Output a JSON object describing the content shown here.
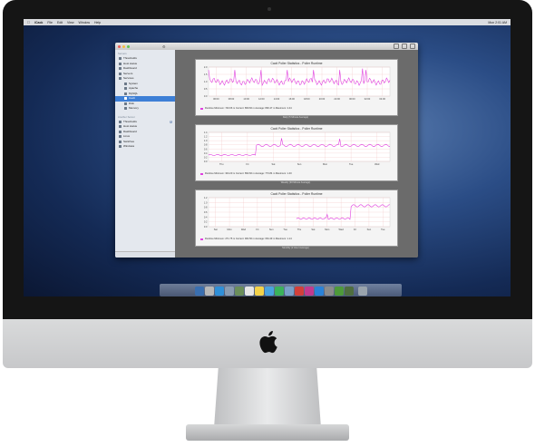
{
  "menubar": {
    "items": [
      "iCack",
      "File",
      "Edit",
      "View",
      "Window",
      "Help"
    ],
    "right": "Mon 2:01 AM"
  },
  "sidebar": {
    "group1_label": "Servers",
    "items": [
      {
        "label": "Thresholds",
        "sub": false
      },
      {
        "label": "Host status",
        "sub": false
      },
      {
        "label": "Dashboard",
        "sub": false
      },
      {
        "label": "Servers",
        "sub": false
      },
      {
        "label": "Services",
        "sub": false
      },
      {
        "label": "System",
        "sub": true
      },
      {
        "label": "Apache",
        "sub": true
      },
      {
        "label": "MySQL",
        "sub": true
      },
      {
        "label": "Cacti",
        "sub": true,
        "selected": true
      },
      {
        "label": "Disk",
        "sub": true
      },
      {
        "label": "Memory",
        "sub": true
      }
    ],
    "group2_label": "Another Server",
    "items2": [
      {
        "label": "Thresholds",
        "badge": "2"
      },
      {
        "label": "Host status"
      },
      {
        "label": "Dashboard"
      },
      {
        "label": "Linux"
      },
      {
        "label": "Switches"
      },
      {
        "label": "Windows"
      }
    ]
  },
  "graphs": [
    {
      "title": "Cacti Poller Statistics - Poller Runtime",
      "legend": "Runtime  Minimum:  740.66 m  Current:  869.66 m  Average:  890.47 m  Maximum:  2.44",
      "caption": "Daily (5 Minute Average)",
      "ylabels": [
        "2.0",
        "1.5",
        "1.0",
        "0.5",
        "0.0"
      ],
      "xlabels": [
        "06:00",
        "08:00",
        "10:00",
        "12:00",
        "14:00",
        "16:00",
        "18:00",
        "20:00",
        "22:00",
        "00:00",
        "02:00",
        "04:00"
      ]
    },
    {
      "title": "Cacti Poller Statistics - Poller Runtime",
      "legend": "Runtime  Minimum:  304.20 m  Current:  893.66 m  Average:  773.84 m  Maximum:  1.40",
      "caption": "Weekly (30 Minute Average)",
      "ylabels": [
        "1.4",
        "1.2",
        "1.0",
        "0.8",
        "0.6",
        "0.4",
        "0.2",
        "0.0"
      ],
      "xlabels": [
        "Thu",
        "Fri",
        "Sat",
        "Sun",
        "Mon",
        "Tue",
        "Wed"
      ]
    },
    {
      "title": "Cacti Poller Statistics - Poller Runtime",
      "legend": "Runtime  Minimum:  271.75 m  Current:  904.56 m  Average:  664.49 m  Maximum:  1.14",
      "caption": "Monthly (2 Hour Average)",
      "ylabels": [
        "1.2",
        "1.0",
        "0.8",
        "0.6",
        "0.4",
        "0.2",
        "0.0"
      ],
      "xlabels": [
        "Sat",
        "Mon",
        "Wed",
        "Fri",
        "Sun",
        "Tue",
        "Thu",
        "Sat",
        "Mon",
        "Wed",
        "Fri",
        "Sun",
        "Tue"
      ]
    }
  ],
  "colors": {
    "accent": "#3d7fd6",
    "series": "#e040e0"
  }
}
